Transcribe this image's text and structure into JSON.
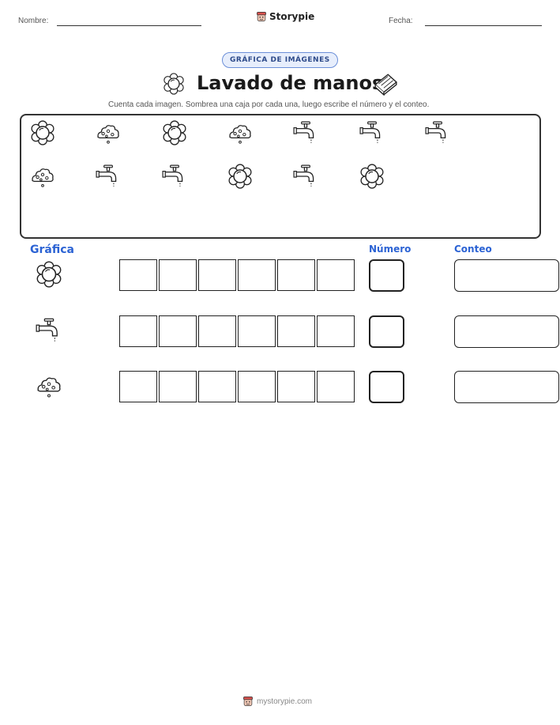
{
  "header": {
    "name_label": "Nombre:",
    "date_label": "Fecha:",
    "brand": "Storypie"
  },
  "badge": "GRÁFICA DE IMÁGENES",
  "title": "Lavado de manos",
  "instructions": "Cuenta cada imagen. Sombrea una caja por cada una, luego escribe el número y el conteo.",
  "pictures": {
    "row1": [
      "soap-bubbles",
      "soap-foam",
      "soap-bubbles",
      "soap-foam",
      "faucet",
      "faucet",
      "faucet"
    ],
    "row2": [
      "soap-foam",
      "faucet",
      "faucet",
      "soap-bubbles",
      "faucet",
      "soap-bubbles"
    ]
  },
  "graph": {
    "label": "Gráfica",
    "number_label": "Número",
    "count_label": "Conteo",
    "boxes_per_row": 6,
    "rows": [
      {
        "icon": "soap-bubbles"
      },
      {
        "icon": "faucet"
      },
      {
        "icon": "soap-foam"
      }
    ]
  },
  "footer": "mystorypie.com"
}
